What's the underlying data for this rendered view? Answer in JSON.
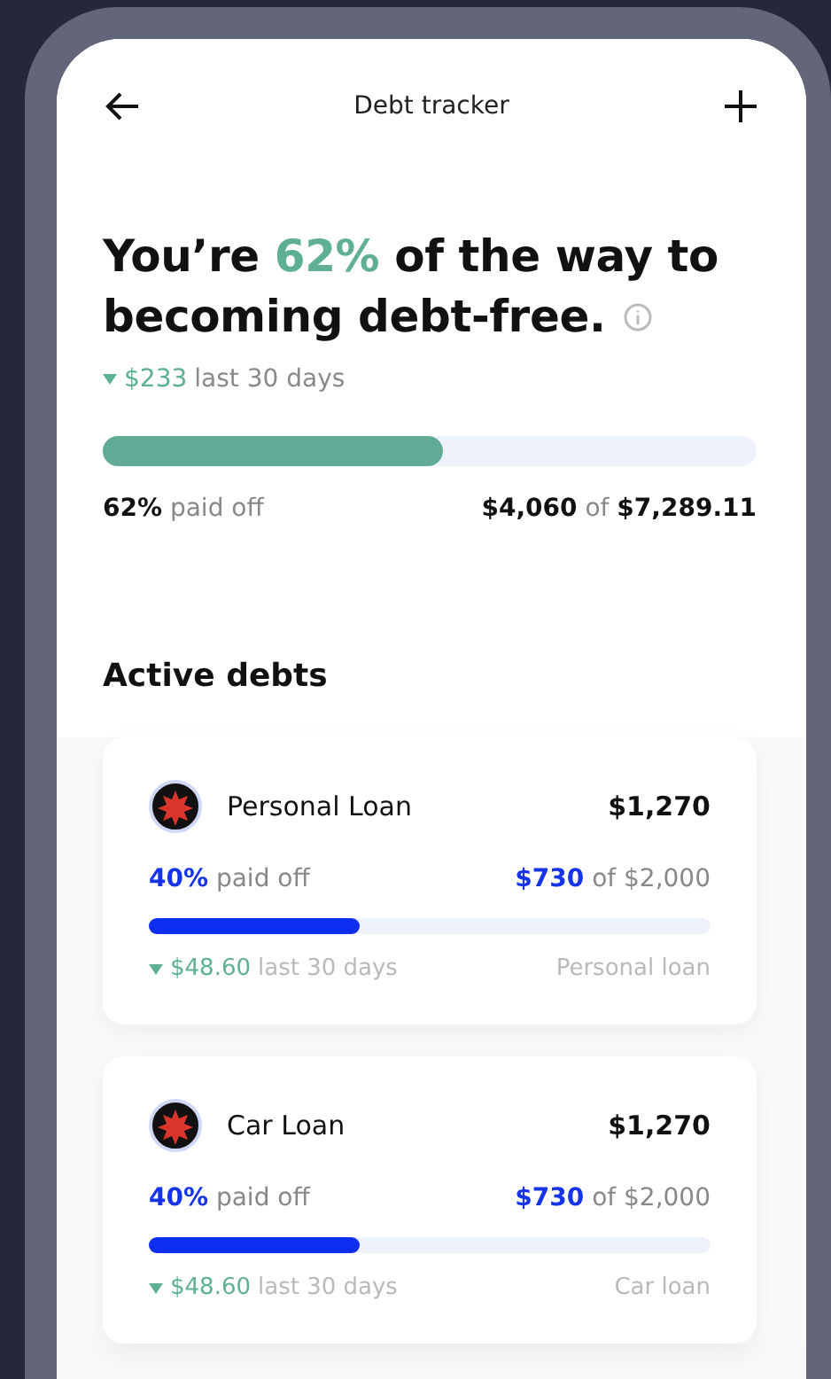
{
  "header": {
    "title": "Debt tracker"
  },
  "summary": {
    "headline_start": "You’re ",
    "headline_highlight": "62%",
    "headline_end": " of the way to",
    "headline_line2": "becoming debt-free.",
    "change": "$233",
    "change_period": "last 30 days",
    "level": 0.52,
    "paid_percent": "62%",
    "paid_label": "paid off",
    "paid_amount": "$4,060",
    "of_label": "of",
    "total_amount": "$7,289.11"
  },
  "section_title": "Active debts",
  "debts": [
    {
      "name": "Personal Loan",
      "balance": "$1,270",
      "paid_percent": "40%",
      "paid_label": "paid off",
      "paid_amount": "$730",
      "of_total": "of $2,000",
      "level": 0.375,
      "change": "$48.60",
      "change_period": "last 30 days",
      "type": "Personal loan"
    },
    {
      "name": "Car Loan",
      "balance": "$1,270",
      "paid_percent": "40%",
      "paid_label": "paid off",
      "paid_amount": "$730",
      "of_total": "of $2,000",
      "level": 0.375,
      "change": "$48.60",
      "change_period": "last 30 days",
      "type": "Car loan"
    }
  ]
}
